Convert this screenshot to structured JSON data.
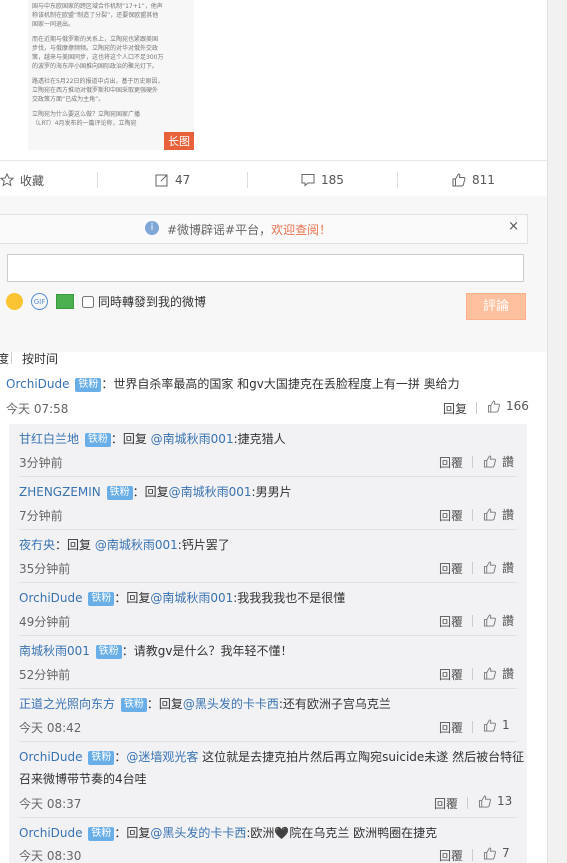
{
  "article": {
    "paragraphs": [
      "国与中东欧国家的跨区域合作机制“17+1”，他声\n称该机制在欧盟“制造了分裂”，还要保欧盟其他\n国家一同退出。",
      "而在近期与俄罗斯的关系上，立陶宛也紧跟美国\n步伐，与俄摩擦频频。立陶宛的对华对俄外交政\n策，越来与美国同步，这也将这个人口不足300万\n的波罗的海东岸小国推向国际政治的聚光灯下。",
      "路透社在5月22日的报道中点出，基于历史原因，\n立陶宛在西方推动对俄罗斯和中国采取更强硬外\n交政策方面“已成为主角”。",
      "立陶宛为什么要这么做？立陶宛国家广播\n（LRT）4月发布的一篇评论称，立陶宛"
    ],
    "badge": "长图"
  },
  "actions": {
    "favorite": "收藏",
    "repost": "47",
    "comment": "185",
    "like": "811"
  },
  "notice": {
    "text": "#微博辟谣#平台，",
    "link": "欢迎查阅！",
    "close": "×"
  },
  "composer": {
    "gif_label": "GIF",
    "sync_label": "同時轉發到我的微博",
    "submit": "評論"
  },
  "sort": {
    "first": "度",
    "second": "按时间"
  },
  "main_comment": {
    "user": "OrchiDude",
    "badge": "铁粉",
    "text": "：世界自杀率最高的国家 和gv大国捷克在丢脸程度上有一拼 奥给力",
    "time": "今天 07:58",
    "reply_label": "回复",
    "likes": "166"
  },
  "replies": [
    {
      "user": "甘红白兰地",
      "badge": "铁粉",
      "pre": "：回复 ",
      "target": "@南城秋雨001",
      "text": ":捷克猎人",
      "time": "3分钟前",
      "reply_label": "回覆",
      "likes": "讚"
    },
    {
      "user": "ZHENGZEMIN",
      "badge": "铁粉",
      "pre": "：回复",
      "target": "@南城秋雨001",
      "text": ":男男片",
      "time": "7分钟前",
      "reply_label": "回覆",
      "likes": "讚"
    },
    {
      "user": "夜冇央",
      "badge": "",
      "pre": "：回复 ",
      "target": "@南城秋雨001",
      "text": ":钙片罢了",
      "time": "35分钟前",
      "reply_label": "回覆",
      "likes": "讚"
    },
    {
      "user": "OrchiDude",
      "badge": "铁粉",
      "pre": "：回复",
      "target": "@南城秋雨001",
      "text": ":我我我我也不是很懂",
      "time": "49分钟前",
      "reply_label": "回覆",
      "likes": "讚"
    },
    {
      "user": "南城秋雨001",
      "badge": "铁粉",
      "pre": "：请教gv是什么？我年轻不懂！",
      "target": "",
      "text": "",
      "time": "52分钟前",
      "reply_label": "回覆",
      "likes": "讚"
    },
    {
      "user": "正道之光照向东方",
      "badge": "铁粉",
      "pre": "：回复",
      "target": "@黑头发的卡卡西",
      "text": ":还有欧洲子宫乌克兰",
      "time": "今天 08:42",
      "reply_label": "回覆",
      "likes": "1"
    },
    {
      "user": "OrchiDude",
      "badge": "铁粉",
      "pre": "：",
      "target": "@迷墙观光客",
      "text": " 这位就是去捷克拍片然后再立陶宛suicide未遂 然后被台特征",
      "text2": "召来微博带节奏的4台哇",
      "time": "今天 08:37",
      "reply_label": "回覆",
      "likes": "13"
    },
    {
      "user": "OrchiDude",
      "badge": "铁粉",
      "pre": "：回复",
      "target": "@黑头发的卡卡西",
      "text": ":欧洲🖤院在乌克兰 欧洲鸭圈在捷克",
      "time": "今天 08:30",
      "reply_label": "回覆",
      "likes": "7"
    }
  ]
}
